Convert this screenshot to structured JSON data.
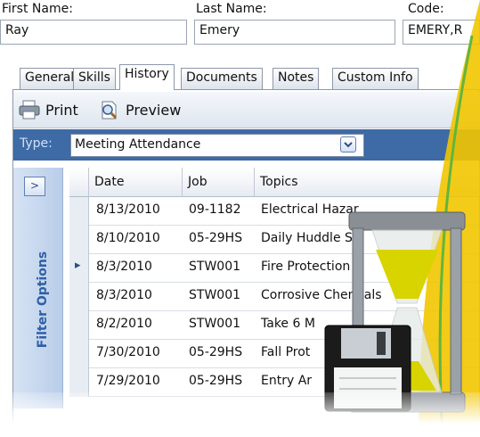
{
  "form": {
    "first_name_label": "First Name:",
    "first_name_value": "Ray",
    "last_name_label": "Last Name:",
    "last_name_value": "Emery",
    "code_label": "Code:",
    "code_value": "EMERY,R"
  },
  "tabs": [
    "General",
    "Skills",
    "History",
    "Documents",
    "Notes",
    "Custom Info"
  ],
  "active_tab": "History",
  "toolbar": {
    "print_label": "Print",
    "preview_label": "Preview"
  },
  "type_filter": {
    "label": "Type:",
    "value": "Meeting Attendance"
  },
  "filter_panel": {
    "label": "Filter Options",
    "expand_symbol": ">"
  },
  "grid": {
    "columns": [
      "Date",
      "Job",
      "Topics"
    ],
    "rows": [
      {
        "date": "8/13/2010",
        "job": "09-1182",
        "topic": "Electrical Hazar"
      },
      {
        "date": "8/10/2010",
        "job": "05-29HS",
        "topic": "Daily Huddle ST"
      },
      {
        "date": "8/3/2010",
        "job": "STW001",
        "topic": "Fire Protection"
      },
      {
        "date": "8/3/2010",
        "job": "STW001",
        "topic": "Corrosive Chem   als"
      },
      {
        "date": "8/2/2010",
        "job": "STW001",
        "topic": "Take 6 M"
      },
      {
        "date": "7/30/2010",
        "job": "05-29HS",
        "topic": "Fall Prot"
      },
      {
        "date": "7/29/2010",
        "job": "05-29HS",
        "topic": "Entry Ar"
      }
    ],
    "current_row_marker": "▸"
  },
  "colors": {
    "accent": "#3e6aa5",
    "filter_text": "#2f5fa8",
    "swoosh_yellow": "#f2c500",
    "swoosh_green": "#63b53b",
    "sand": "#d8d400"
  },
  "icons": [
    "printer-icon",
    "preview-icon",
    "dropdown-icon",
    "hourglass-icon",
    "floppy-disk-icon"
  ]
}
